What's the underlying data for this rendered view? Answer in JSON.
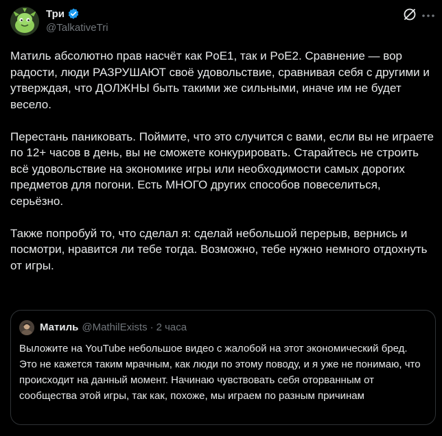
{
  "author": {
    "display_name": "Три",
    "handle": "@TalkativeTri",
    "verified": true,
    "avatar_icon": "dinosaur-avatar"
  },
  "actions": {
    "grok_icon": "grok-icon",
    "more_icon": "more-icon"
  },
  "post": {
    "paragraphs": [
      "Матиль абсолютно прав насчёт как PoE1, так и PoE2. Сравнение — вор радости, люди РАЗРУШАЮТ своё удовольствие, сравнивая себя с другими и утверждая, что ДОЛЖНЫ быть такими же сильными, иначе им не будет весело.",
      "Перестань паниковать. Поймите, что это случится с вами, если вы не играете по 12+ часов в день, вы не сможете конкурировать. Старайтесь не строить всё удовольствие на экономике игры или необходимости самых дорогих предметов для погони. Есть МНОГО других способов повеселиться, серьёзно.",
      "Также попробуй то, что сделал я: сделай небольшой перерыв, вернись и посмотри, нравится ли тебе тогда. Возможно, тебе нужно немного отдохнуть от игры."
    ]
  },
  "quoted": {
    "display_name": "Матиль",
    "handle": "@MathilExists",
    "separator": "·",
    "time": "2 часа",
    "text": "Выложите на YouTube небольшое видео с жалобой на этот экономический бред. Это не кажется таким мрачным, как люди по этому поводу, и я уже не понимаю, что происходит на данный момент. Начинаю чувствовать себя оторванным от сообщества этой игры, так как, похоже, мы играем по разным причинам"
  },
  "colors": {
    "background": "#000000",
    "text": "#e7e9ea",
    "secondary": "#71767b",
    "verified": "#1d9bf0",
    "border": "#2f3336"
  }
}
